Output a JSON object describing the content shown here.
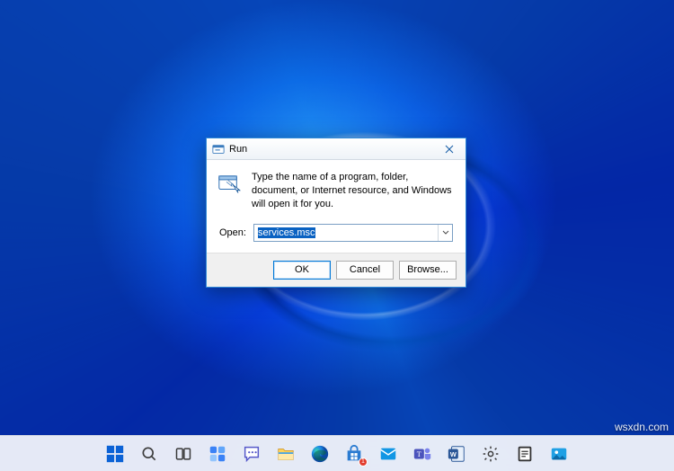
{
  "run_dialog": {
    "title": "Run",
    "description": "Type the name of a program, folder, document, or Internet resource, and Windows will open it for you.",
    "open_label": "Open:",
    "open_value": "services.msc",
    "buttons": {
      "ok": "OK",
      "cancel": "Cancel",
      "browse": "Browse..."
    }
  },
  "taskbar": {
    "items": [
      {
        "name": "start-icon",
        "label": "Start"
      },
      {
        "name": "search-icon",
        "label": "Search"
      },
      {
        "name": "task-view-icon",
        "label": "Task View"
      },
      {
        "name": "widgets-icon",
        "label": "Widgets"
      },
      {
        "name": "chat-icon",
        "label": "Chat"
      },
      {
        "name": "file-explorer-icon",
        "label": "File Explorer"
      },
      {
        "name": "edge-icon",
        "label": "Microsoft Edge"
      },
      {
        "name": "store-icon",
        "label": "Microsoft Store",
        "badge": "1"
      },
      {
        "name": "mail-icon",
        "label": "Mail"
      },
      {
        "name": "teams-icon",
        "label": "Microsoft Teams"
      },
      {
        "name": "word-icon",
        "label": "Word"
      },
      {
        "name": "settings-icon",
        "label": "Settings"
      },
      {
        "name": "notes-icon",
        "label": "Notes"
      },
      {
        "name": "photos-icon",
        "label": "Photos"
      }
    ]
  },
  "watermark": "wsxdn.com"
}
